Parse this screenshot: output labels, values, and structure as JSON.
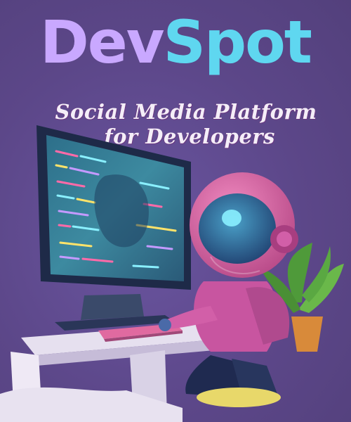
{
  "brand": {
    "name_part1": "Dev",
    "name_part2": "Spot",
    "color_part1": "#c9a8ff",
    "color_part2": "#5fd7f0"
  },
  "tagline": {
    "line1": "Social Media Platform",
    "line2": "for Developers"
  },
  "colors": {
    "background": "#5f4a8e",
    "astronaut": "#d55fa0",
    "screen_code": "#3a8aa0"
  },
  "illustration": {
    "subject": "astronaut-coding-at-computer-icon",
    "plant": "potted-plant-icon"
  }
}
